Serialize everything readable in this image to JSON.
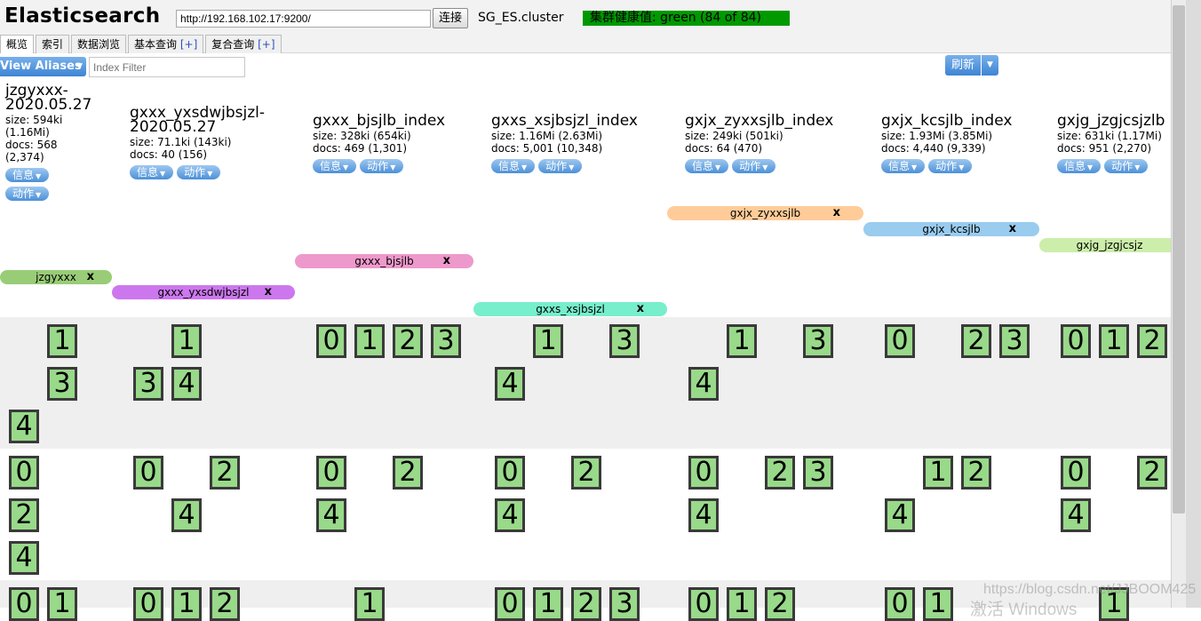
{
  "header": {
    "app_title": "Elasticsearch",
    "url_value": "http://192.168.102.17:9200/",
    "connect_label": "连接",
    "cluster_name": "SG_ES.cluster",
    "health_text": "集群健康值: green (84 of 84)",
    "health_color": "#009900"
  },
  "tabs": [
    {
      "label": "概览",
      "plus": ""
    },
    {
      "label": "索引",
      "plus": ""
    },
    {
      "label": "数据浏览",
      "plus": ""
    },
    {
      "label": "基本查询 ",
      "plus": "[+]"
    },
    {
      "label": "复合查询 ",
      "plus": "[+]"
    }
  ],
  "toolbar": {
    "aliases_label": "View Aliases",
    "filter_placeholder": "Index Filter",
    "refresh_label": "刷新"
  },
  "pills": {
    "info": "信息",
    "action": "动作"
  },
  "indices": [
    {
      "name": "jzgyxxx-2020.05.27",
      "size": "size: 594ki (1.16Mi)",
      "docs": "docs: 568 (2,374)"
    },
    {
      "name": "gxxx_yxsdwjbsjzl-2020.05.27",
      "size": "size: 71.1ki (143ki)",
      "docs": "docs: 40 (156)"
    },
    {
      "name": "gxxx_bjsjlb_index",
      "size": "size: 328ki (654ki)",
      "docs": "docs: 469 (1,301)"
    },
    {
      "name": "gxxs_xsjbsjzl_index",
      "size": "size: 1.16Mi (2.63Mi)",
      "docs": "docs: 5,001 (10,348)"
    },
    {
      "name": "gxjx_zyxxsjlb_index",
      "size": "size: 249ki (501ki)",
      "docs": "docs: 64 (470)"
    },
    {
      "name": "gxjx_kcsjlb_index",
      "size": "size: 1.93Mi (3.85Mi)",
      "docs": "docs: 4,440 (9,339)"
    },
    {
      "name": "gxjg_jzgjcsjzlb",
      "size": "size: 631ki (1.17Mi)",
      "docs": "docs: 951 (2,270)"
    }
  ],
  "aliases": [
    {
      "label": "jzgyxxx",
      "close": "x",
      "color": "#99cc77"
    },
    {
      "label": "gxxx_yxsdwjbsjzl",
      "close": "x",
      "color": "#cc77ee"
    },
    {
      "label": "gxxx_bjsjlb",
      "close": "x",
      "color": "#ee99cc"
    },
    {
      "label": "gxxs_xsjbsjzl",
      "close": "x",
      "color": "#77eecc"
    },
    {
      "label": "gxjx_zyxxsjlb",
      "close": "x",
      "color": "#ffcc99"
    },
    {
      "label": "gxjx_kcsjlb",
      "close": "x",
      "color": "#99ccee"
    },
    {
      "label": "gxjg_jzgjcsjz",
      "close": "",
      "color": "#cceeaa"
    }
  ],
  "nodes": [
    {
      "shards": [
        [
          "1",
          "3",
          "4"
        ],
        [
          "1",
          "3",
          "4"
        ],
        [
          "0",
          "1",
          "2",
          "3"
        ],
        [
          "1",
          "3",
          "4"
        ],
        [
          "1",
          "3",
          "4"
        ],
        [
          "0",
          "2",
          "3"
        ],
        [
          "0",
          "1",
          "2"
        ]
      ]
    },
    {
      "shards": [
        [
          "0",
          "2",
          "4"
        ],
        [
          "0",
          "2",
          "4"
        ],
        [
          "0",
          "2",
          "4"
        ],
        [
          "0",
          "2",
          "4"
        ],
        [
          "0",
          "2",
          "3",
          "4"
        ],
        [
          "1",
          "2",
          "4"
        ],
        [
          "0",
          "2",
          "4"
        ]
      ]
    },
    {
      "shards": [
        [
          "0",
          "1"
        ],
        [
          "0",
          "1",
          "2"
        ],
        [
          "1"
        ],
        [
          "0",
          "1",
          "2",
          "3"
        ],
        [
          "0",
          "1",
          "2"
        ],
        [
          "0",
          "1"
        ],
        [
          "1"
        ]
      ]
    }
  ],
  "shard_color": "#99d98a",
  "watermark": {
    "line1": "https://blog.csdn.net/JJBOOM425",
    "line2": "激活 Windows"
  }
}
